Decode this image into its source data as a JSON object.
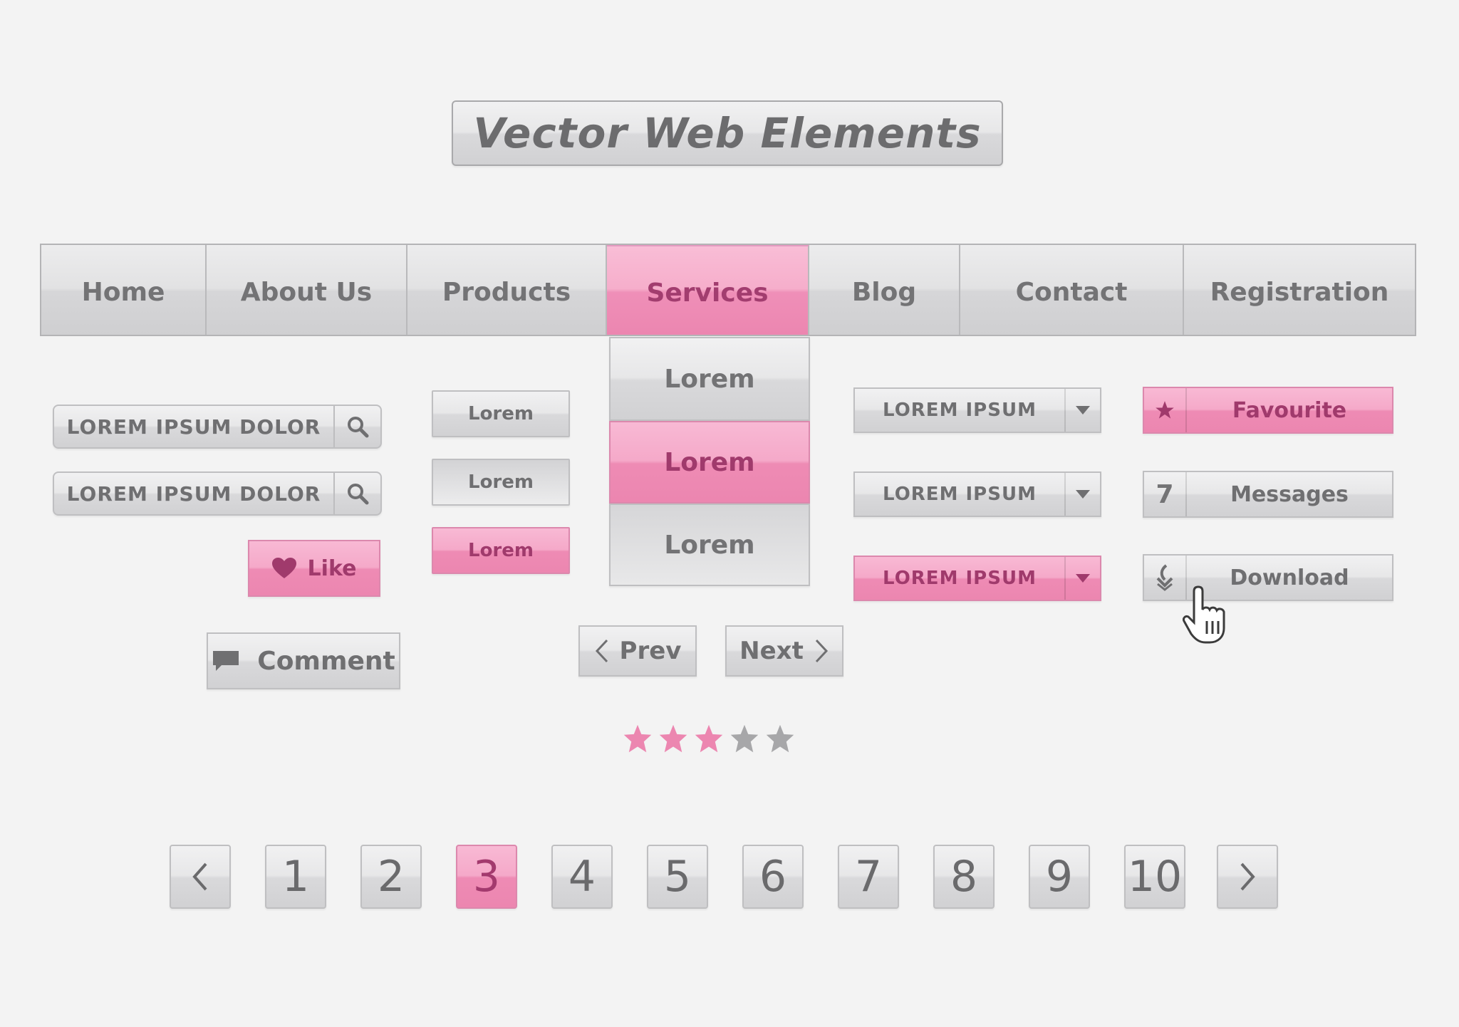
{
  "title": "Vector Web Elements",
  "nav": [
    {
      "label": "Home",
      "active": false
    },
    {
      "label": "About Us",
      "active": false
    },
    {
      "label": "Products",
      "active": false
    },
    {
      "label": "Services",
      "active": true
    },
    {
      "label": "Blog",
      "active": false
    },
    {
      "label": "Contact",
      "active": false
    },
    {
      "label": "Registration",
      "active": false
    }
  ],
  "dropdown": [
    "Lorem",
    "Lorem",
    "Lorem"
  ],
  "search_bars": [
    {
      "value": "LOREM IPSUM DOLOR",
      "icon": "search-icon"
    },
    {
      "value": "LOREM IPSUM DOLOR",
      "icon": "search-icon"
    }
  ],
  "small_buttons": [
    "Lorem",
    "Lorem",
    "Lorem"
  ],
  "selects": [
    "LOREM IPSUM",
    "LOREM IPSUM",
    "LOREM IPSUM"
  ],
  "right_buttons": {
    "favourite": "Favourite",
    "messages_count": "7",
    "messages": "Messages",
    "download": "Download"
  },
  "like": "Like",
  "comment": "Comment",
  "prev": "Prev",
  "next": "Next",
  "rating": {
    "value": 3,
    "max": 5
  },
  "pagination": [
    "1",
    "2",
    "3",
    "4",
    "5",
    "6",
    "7",
    "8",
    "9",
    "10"
  ],
  "pagination_current": "3",
  "colors": {
    "accent_pink": "#ec86b0",
    "accent_text": "#a03a6c",
    "gray": "#d9d9db",
    "star_gray": "#a7a7a9"
  }
}
